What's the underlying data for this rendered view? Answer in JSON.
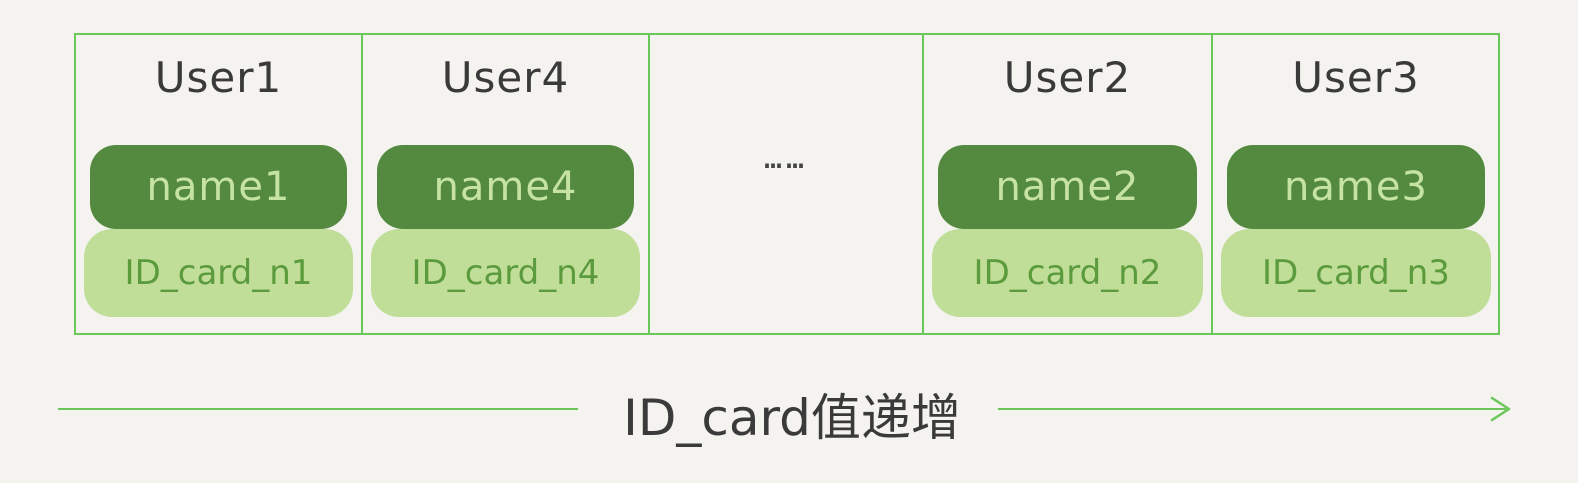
{
  "records": [
    {
      "user": "User1",
      "name": "name1",
      "id_card": "ID_card_n1"
    },
    {
      "user": "User4",
      "name": "name4",
      "id_card": "ID_card_n4"
    },
    {
      "ellipsis": "……"
    },
    {
      "user": "User2",
      "name": "name2",
      "id_card": "ID_card_n2"
    },
    {
      "user": "User3",
      "name": "name3",
      "id_card": "ID_card_n3"
    }
  ],
  "axis": {
    "label": "ID_card值递增",
    "direction": "right"
  },
  "colors": {
    "border": "#6cc75a",
    "name_bg": "#548a3f",
    "name_text": "#c6e3a4",
    "id_bg": "#c1de99",
    "id_text": "#5b9b3d",
    "title_text": "#3a3a3a",
    "background": "#f4f3ef"
  },
  "icons": {
    "axis_end": "arrow-right-icon"
  }
}
